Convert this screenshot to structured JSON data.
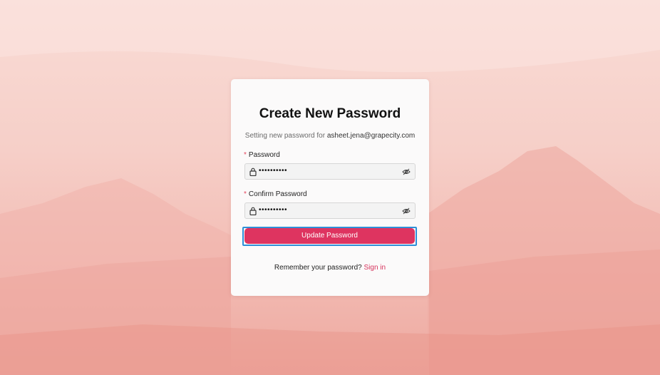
{
  "page": {
    "title": "Create New Password",
    "subtitle_prefix": "Setting new password for",
    "email": "asheet.jena@grapecity.com"
  },
  "form": {
    "password": {
      "label": "Password",
      "required_marker": "*",
      "masked_value": "••••••••••",
      "icon": "lock-icon",
      "toggle_icon": "eye-slash-icon"
    },
    "confirm_password": {
      "label": "Confirm Password",
      "required_marker": "*",
      "masked_value": "••••••••••",
      "icon": "lock-icon",
      "toggle_icon": "eye-slash-icon"
    },
    "submit_label": "Update Password"
  },
  "footer": {
    "prompt": "Remember your password?",
    "link_label": "Sign in"
  },
  "colors": {
    "accent": "#de3460",
    "link": "#d6335c",
    "focus_ring": "#2d8fd8",
    "required": "#e5475f"
  }
}
